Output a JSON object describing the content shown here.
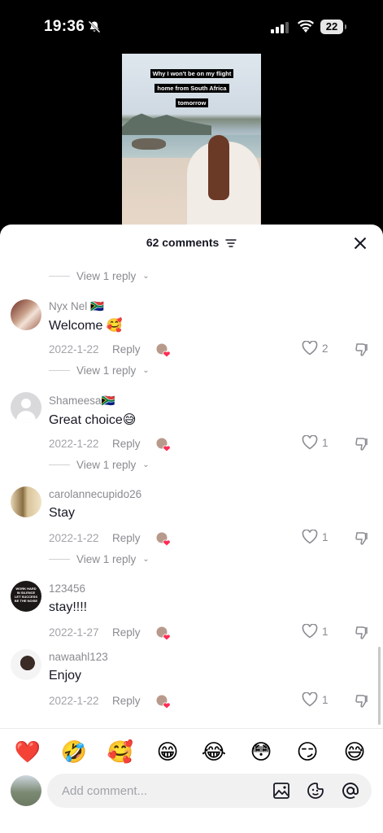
{
  "status_bar": {
    "time": "19:36",
    "battery": "22"
  },
  "video": {
    "caption_lines": [
      "Why I won't be on my flight",
      "home from South Africa",
      "tomorrow"
    ]
  },
  "sheet": {
    "title": "62 comments"
  },
  "top_partial": {
    "view_replies": "View 1 reply"
  },
  "comments": [
    {
      "username": "Nyx Nel 🇿🇦",
      "text": "Welcome 🥰",
      "date": "2022-1-22",
      "reply": "Reply",
      "likes": "2",
      "view_replies": "View 1 reply"
    },
    {
      "username": "Shameesa🇿🇦",
      "text": "Great choice😅",
      "date": "2022-1-22",
      "reply": "Reply",
      "likes": "1",
      "view_replies": "View 1 reply"
    },
    {
      "username": "carolannecupido26",
      "text": "Stay",
      "date": "2022-1-22",
      "reply": "Reply",
      "likes": "1",
      "view_replies": "View 1 reply"
    },
    {
      "username": "123456",
      "text": "stay!!!!",
      "date": "2022-1-27",
      "reply": "Reply",
      "likes": "1",
      "avatar_text": "WORK HARD IN SILENCE LET SUCCESS BE THE NOISE"
    },
    {
      "username": "nawaahl123",
      "text": "Enjoy",
      "date": "2022-1-22",
      "reply": "Reply",
      "likes": "1"
    }
  ],
  "emoji_bar": [
    "❤️",
    "🤣",
    "🥰",
    "😁",
    "😂",
    "😳",
    "😏",
    "😅"
  ],
  "input": {
    "placeholder": "Add comment..."
  },
  "colors": {
    "heart": "#fe2c55",
    "text": "#161823",
    "muted": "#8a8b91"
  },
  "icons": [
    "bell-slash-icon",
    "wifi-icon",
    "filter-icon",
    "close-icon",
    "heart-outline-icon",
    "dislike-icon",
    "image-icon",
    "sticker-icon",
    "mention-icon"
  ]
}
